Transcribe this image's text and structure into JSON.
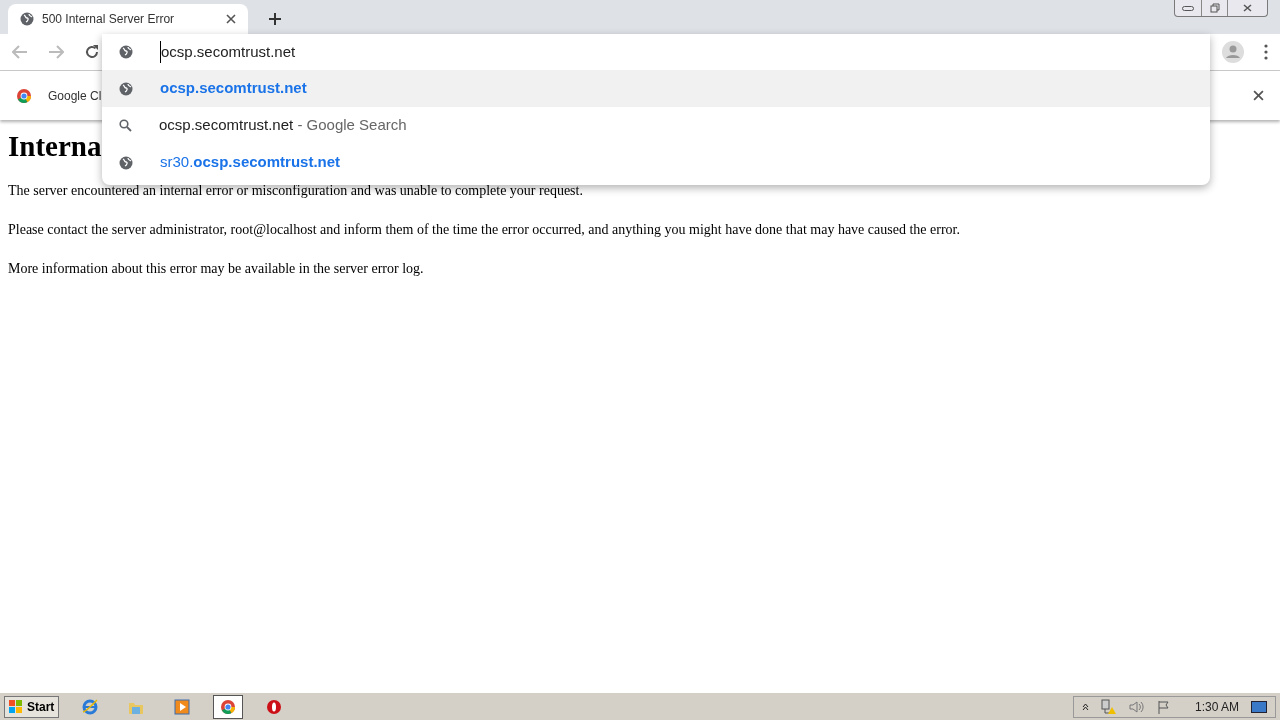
{
  "tab": {
    "title": "500 Internal Server Error",
    "selected": true
  },
  "omnibox": {
    "value": "ocsp.secomtrust.net"
  },
  "suggestions": [
    {
      "kind": "url",
      "text": "**ocsp.secomtrust.net**",
      "selected": true
    },
    {
      "kind": "search",
      "text": "ocsp.secomtrust.net",
      "suffix": "- Google Search",
      "selected": false
    },
    {
      "kind": "url",
      "text": "sr30.**ocsp.secomtrust.net**",
      "selected": false
    }
  ],
  "infobar": {
    "text": "Google Cl"
  },
  "page": {
    "heading": "Interna",
    "paragraphs": [
      "The server encountered an internal error or misconfiguration and was unable to complete your request.",
      "Please contact the server administrator, root@localhost and inform them of the time the error occurred, and anything you might have done that may have caused the error.",
      "More information about this error may be available in the server error log."
    ]
  },
  "taskbar": {
    "start": "Start",
    "apps": [
      {
        "kind": "ie",
        "selected": false
      },
      {
        "kind": "folder",
        "selected": false
      },
      {
        "kind": "media",
        "selected": false
      },
      {
        "kind": "chrome",
        "selected": true
      },
      {
        "kind": "opera",
        "selected": false
      }
    ],
    "clock": "1:30 AM"
  }
}
